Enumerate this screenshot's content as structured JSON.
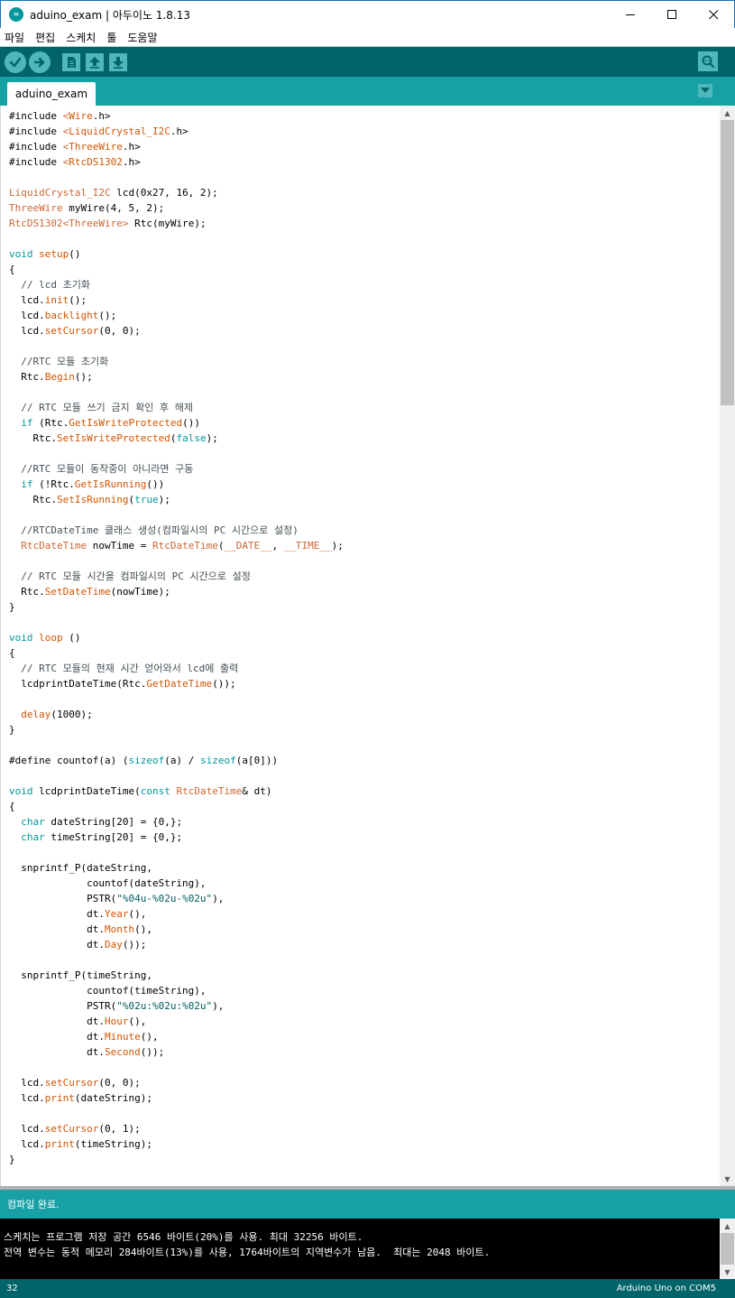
{
  "window": {
    "title": "aduino_exam | 아두이노 1.8.13",
    "app_icon_glyph": "∞",
    "controls": [
      "minimize-icon",
      "maximize-icon",
      "close-icon"
    ]
  },
  "menu": [
    "파일",
    "편집",
    "스케치",
    "툴",
    "도움말"
  ],
  "toolbar": {
    "buttons": [
      "verify-icon",
      "upload-icon",
      "new-icon",
      "open-icon",
      "save-icon"
    ],
    "right_button": "serial-monitor-icon"
  },
  "tab": {
    "label": "aduino_exam",
    "menu_icon": "chevron-down-icon"
  },
  "code_lines": [
    [
      [
        "p",
        "#include "
      ],
      [
        "t",
        "<"
      ],
      [
        "f",
        "Wire"
      ],
      [
        "p",
        ".h>"
      ]
    ],
    [
      [
        "p",
        "#include "
      ],
      [
        "t",
        "<"
      ],
      [
        "f",
        "LiquidCrystal_I2C"
      ],
      [
        "p",
        ".h>"
      ]
    ],
    [
      [
        "p",
        "#include "
      ],
      [
        "t",
        "<"
      ],
      [
        "f",
        "ThreeWire"
      ],
      [
        "p",
        ".h>"
      ]
    ],
    [
      [
        "p",
        "#include "
      ],
      [
        "t",
        "<"
      ],
      [
        "f",
        "RtcDS1302"
      ],
      [
        "p",
        ".h>"
      ]
    ],
    [],
    [
      [
        "t",
        "LiquidCrystal_I2C"
      ],
      [
        "p",
        " lcd(0x27, 16, 2);"
      ]
    ],
    [
      [
        "t",
        "ThreeWire"
      ],
      [
        "p",
        " myWire(4, 5, 2);"
      ]
    ],
    [
      [
        "t",
        "RtcDS1302"
      ],
      [
        "t",
        "<ThreeWire>"
      ],
      [
        "p",
        " Rtc(myWire);"
      ]
    ],
    [],
    [
      [
        "k",
        "void"
      ],
      [
        "p",
        " "
      ],
      [
        "f",
        "setup"
      ],
      [
        "p",
        "()"
      ]
    ],
    [
      [
        "p",
        "{"
      ]
    ],
    [
      [
        "c",
        "  // lcd 초기화"
      ]
    ],
    [
      [
        "p",
        "  lcd."
      ],
      [
        "f",
        "init"
      ],
      [
        "p",
        "();"
      ]
    ],
    [
      [
        "p",
        "  lcd."
      ],
      [
        "f",
        "backlight"
      ],
      [
        "p",
        "();"
      ]
    ],
    [
      [
        "p",
        "  lcd."
      ],
      [
        "f",
        "setCursor"
      ],
      [
        "p",
        "(0, 0);"
      ]
    ],
    [],
    [
      [
        "c",
        "  //RTC 모듈 초기화"
      ]
    ],
    [
      [
        "p",
        "  Rtc."
      ],
      [
        "f",
        "Begin"
      ],
      [
        "p",
        "();"
      ]
    ],
    [],
    [
      [
        "c",
        "  // RTC 모듈 쓰기 금지 확인 후 해제"
      ]
    ],
    [
      [
        "p",
        "  "
      ],
      [
        "k",
        "if"
      ],
      [
        "p",
        " (Rtc."
      ],
      [
        "f",
        "GetIsWriteProtected"
      ],
      [
        "p",
        "())"
      ]
    ],
    [
      [
        "p",
        "    Rtc."
      ],
      [
        "f",
        "SetIsWriteProtected"
      ],
      [
        "p",
        "("
      ],
      [
        "k",
        "false"
      ],
      [
        "p",
        ");"
      ]
    ],
    [],
    [
      [
        "c",
        "  //RTC 모듈이 동작중이 아니라면 구동"
      ]
    ],
    [
      [
        "p",
        "  "
      ],
      [
        "k",
        "if"
      ],
      [
        "p",
        " (!Rtc."
      ],
      [
        "f",
        "GetIsRunning"
      ],
      [
        "p",
        "())"
      ]
    ],
    [
      [
        "p",
        "    Rtc."
      ],
      [
        "f",
        "SetIsRunning"
      ],
      [
        "p",
        "("
      ],
      [
        "k",
        "true"
      ],
      [
        "p",
        ");"
      ]
    ],
    [],
    [
      [
        "c",
        "  //RTCDateTime 클래스 생성(컴파일시의 PC 시간으로 설정)"
      ]
    ],
    [
      [
        "p",
        "  "
      ],
      [
        "t",
        "RtcDateTime"
      ],
      [
        "p",
        " nowTime = "
      ],
      [
        "t",
        "RtcDateTime"
      ],
      [
        "p",
        "("
      ],
      [
        "t",
        "__DATE__"
      ],
      [
        "p",
        ", "
      ],
      [
        "t",
        "__TIME__"
      ],
      [
        "p",
        ");"
      ]
    ],
    [],
    [
      [
        "c",
        "  // RTC 모듈 시간을 컴파일시의 PC 시간으로 설정"
      ]
    ],
    [
      [
        "p",
        "  Rtc."
      ],
      [
        "f",
        "SetDateTime"
      ],
      [
        "p",
        "(nowTime);"
      ]
    ],
    [
      [
        "p",
        "}"
      ]
    ],
    [],
    [
      [
        "k",
        "void"
      ],
      [
        "p",
        " "
      ],
      [
        "f",
        "loop"
      ],
      [
        "p",
        " ()"
      ]
    ],
    [
      [
        "p",
        "{"
      ]
    ],
    [
      [
        "c",
        "  // RTC 모듈의 현재 시간 얻어와서 lcd에 출력"
      ]
    ],
    [
      [
        "p",
        "  lcdprintDateTime(Rtc."
      ],
      [
        "f",
        "GetDateTime"
      ],
      [
        "p",
        "());"
      ]
    ],
    [],
    [
      [
        "p",
        "  "
      ],
      [
        "f",
        "delay"
      ],
      [
        "p",
        "(1000);"
      ]
    ],
    [
      [
        "p",
        "}"
      ]
    ],
    [],
    [
      [
        "p",
        "#define countof(a) ("
      ],
      [
        "k",
        "sizeof"
      ],
      [
        "p",
        "(a) / "
      ],
      [
        "k",
        "sizeof"
      ],
      [
        "p",
        "(a[0]))"
      ]
    ],
    [],
    [
      [
        "k",
        "void"
      ],
      [
        "p",
        " lcdprintDateTime("
      ],
      [
        "k",
        "const"
      ],
      [
        "p",
        " "
      ],
      [
        "t",
        "RtcDateTime"
      ],
      [
        "p",
        "& dt)"
      ]
    ],
    [
      [
        "p",
        "{"
      ]
    ],
    [
      [
        "p",
        "  "
      ],
      [
        "k",
        "char"
      ],
      [
        "p",
        " dateString[20] = {0,};"
      ]
    ],
    [
      [
        "p",
        "  "
      ],
      [
        "k",
        "char"
      ],
      [
        "p",
        " timeString[20] = {0,};"
      ]
    ],
    [],
    [
      [
        "p",
        "  snprintf_P(dateString,"
      ]
    ],
    [
      [
        "p",
        "             countof(dateString),"
      ]
    ],
    [
      [
        "p",
        "             PSTR("
      ],
      [
        "s",
        "\"%04u-%02u-%02u\""
      ],
      [
        "p",
        "),"
      ]
    ],
    [
      [
        "p",
        "             dt."
      ],
      [
        "f",
        "Year"
      ],
      [
        "p",
        "(),"
      ]
    ],
    [
      [
        "p",
        "             dt."
      ],
      [
        "f",
        "Month"
      ],
      [
        "p",
        "(),"
      ]
    ],
    [
      [
        "p",
        "             dt."
      ],
      [
        "f",
        "Day"
      ],
      [
        "p",
        "());"
      ]
    ],
    [],
    [
      [
        "p",
        "  snprintf_P(timeString,"
      ]
    ],
    [
      [
        "p",
        "             countof(timeString),"
      ]
    ],
    [
      [
        "p",
        "             PSTR("
      ],
      [
        "s",
        "\"%02u:%02u:%02u\""
      ],
      [
        "p",
        "),"
      ]
    ],
    [
      [
        "p",
        "             dt."
      ],
      [
        "f",
        "Hour"
      ],
      [
        "p",
        "(),"
      ]
    ],
    [
      [
        "p",
        "             dt."
      ],
      [
        "f",
        "Minute"
      ],
      [
        "p",
        "(),"
      ]
    ],
    [
      [
        "p",
        "             dt."
      ],
      [
        "f",
        "Second"
      ],
      [
        "p",
        "());"
      ]
    ],
    [],
    [
      [
        "p",
        "  lcd."
      ],
      [
        "f",
        "setCursor"
      ],
      [
        "p",
        "(0, 0);"
      ]
    ],
    [
      [
        "p",
        "  lcd."
      ],
      [
        "f",
        "print"
      ],
      [
        "p",
        "(dateString);"
      ]
    ],
    [],
    [
      [
        "p",
        "  lcd."
      ],
      [
        "f",
        "setCursor"
      ],
      [
        "p",
        "(0, 1);"
      ]
    ],
    [
      [
        "p",
        "  lcd."
      ],
      [
        "f",
        "print"
      ],
      [
        "p",
        "(timeString);"
      ]
    ],
    [
      [
        "p",
        "}"
      ]
    ]
  ],
  "status": {
    "message": "컴파일 완료."
  },
  "console": {
    "lines": [
      "스케치는 프로그램 저장 공간 6546 바이트(20%)를 사용. 최대 32256 바이트.",
      "전역 변수는 동적 메모리 284바이트(13%)를 사용, 1764바이트의 지역변수가 남음.  최대는 2048 바이트."
    ]
  },
  "footer": {
    "line_number": "32",
    "board": "Arduino Uno on COM5"
  },
  "colors": {
    "toolbar": "#006468",
    "tabbar": "#17a1a5",
    "keyword": "#00979c",
    "function": "#d35400",
    "type": "#cc6633",
    "comment": "#434f54",
    "string": "#005c5f"
  }
}
